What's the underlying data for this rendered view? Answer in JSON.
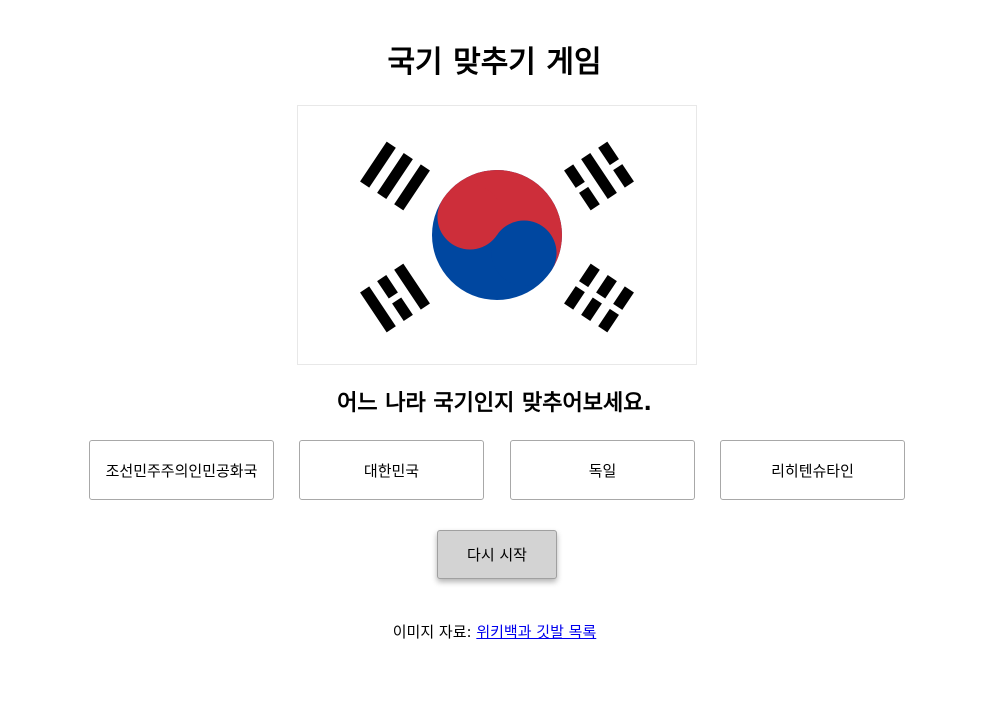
{
  "title": "국기 맞추기 게임",
  "flag": {
    "name": "korea-flag",
    "colors": {
      "red": "#cd2e3a",
      "blue": "#0047a0",
      "black": "#000000",
      "background": "#ffffff"
    }
  },
  "question": "어느 나라 국기인지 맞추어보세요.",
  "options": [
    {
      "label": "조선민주주의인민공화국"
    },
    {
      "label": "대한민국"
    },
    {
      "label": "독일"
    },
    {
      "label": "리히텐슈타인"
    }
  ],
  "restart_label": "다시 시작",
  "credit": {
    "prefix": "이미지 자료: ",
    "link_text": "위키백과 깃발 목록"
  }
}
